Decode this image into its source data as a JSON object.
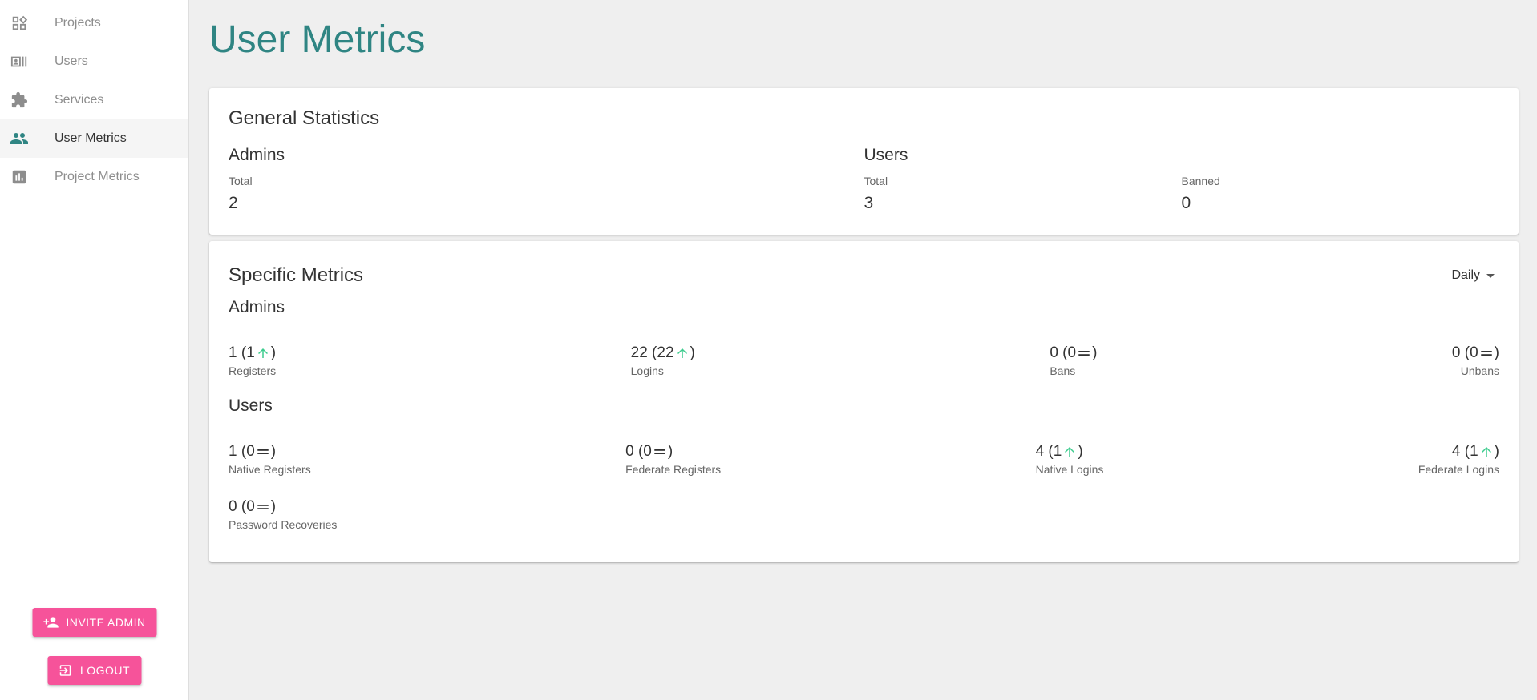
{
  "sidebar": {
    "items": [
      {
        "label": "Projects",
        "icon": "dashboard-icon"
      },
      {
        "label": "Users",
        "icon": "badge-icon"
      },
      {
        "label": "Services",
        "icon": "extension-icon"
      },
      {
        "label": "User Metrics",
        "icon": "people-icon"
      },
      {
        "label": "Project Metrics",
        "icon": "bar-chart-icon"
      }
    ],
    "invite_label": "INVITE ADMIN",
    "logout_label": "LOGOUT"
  },
  "page": {
    "title": "User Metrics"
  },
  "general": {
    "title": "General Statistics",
    "admins": {
      "heading": "Admins",
      "total_label": "Total",
      "total_value": "2"
    },
    "users": {
      "heading": "Users",
      "total_label": "Total",
      "total_value": "3",
      "banned_label": "Banned",
      "banned_value": "0"
    }
  },
  "specific": {
    "title": "Specific Metrics",
    "period": "Daily",
    "admins": {
      "heading": "Admins",
      "metrics": [
        {
          "value": "1",
          "delta": "1",
          "trend": "up",
          "label": "Registers"
        },
        {
          "value": "22",
          "delta": "22",
          "trend": "up",
          "label": "Logins"
        },
        {
          "value": "0",
          "delta": "0",
          "trend": "flat",
          "label": "Bans"
        },
        {
          "value": "0",
          "delta": "0",
          "trend": "flat",
          "label": "Unbans"
        }
      ]
    },
    "users": {
      "heading": "Users",
      "metrics": [
        {
          "value": "1",
          "delta": "0",
          "trend": "flat",
          "label": "Native Registers"
        },
        {
          "value": "0",
          "delta": "0",
          "trend": "flat",
          "label": "Federate Registers"
        },
        {
          "value": "4",
          "delta": "1",
          "trend": "up",
          "label": "Native Logins"
        },
        {
          "value": "4",
          "delta": "1",
          "trend": "up",
          "label": "Federate Logins"
        }
      ],
      "extra": {
        "value": "0",
        "delta": "0",
        "trend": "flat",
        "label": "Password Recoveries"
      }
    }
  },
  "colors": {
    "accent": "#2f8583",
    "button": "#f6539a",
    "trend_up": "#3dcc8e",
    "trend_flat": "#333333"
  }
}
